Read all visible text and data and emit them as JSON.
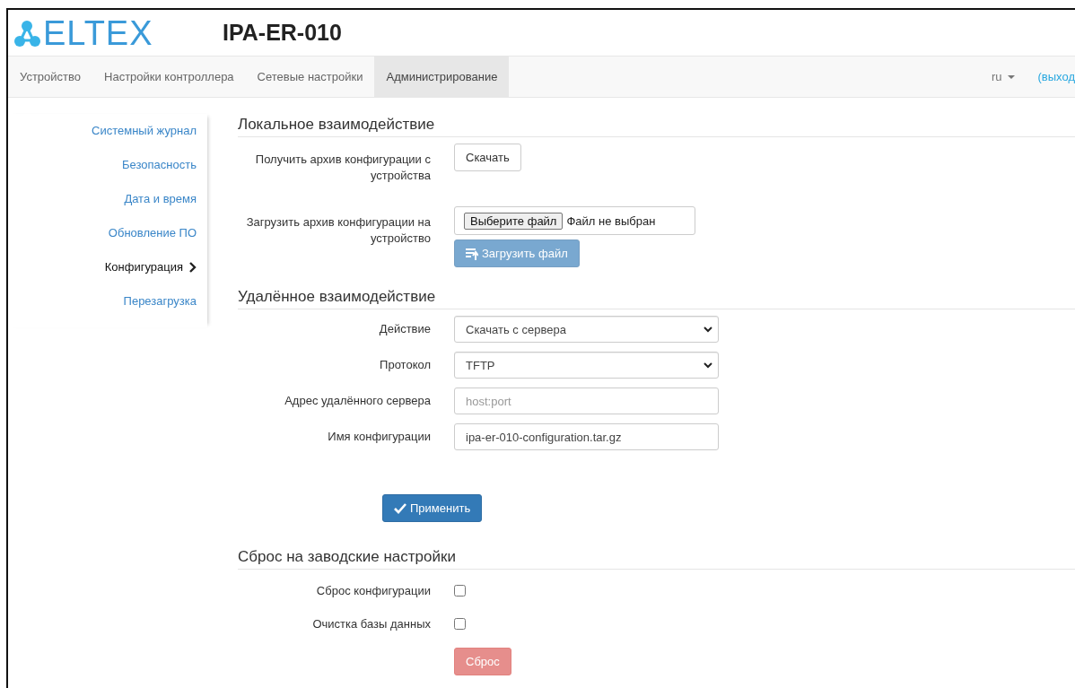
{
  "header": {
    "logo_text": "ELTEX",
    "title": "IPA-ER-010"
  },
  "navbar": {
    "tabs": [
      {
        "label": "Устройство",
        "selected": false
      },
      {
        "label": "Настройки контроллера",
        "selected": false
      },
      {
        "label": "Сетевые настройки",
        "selected": false
      },
      {
        "label": "Администрирование",
        "selected": true
      }
    ],
    "language": "ru",
    "logout": "(выход"
  },
  "sidebar": {
    "items": [
      {
        "label": "Системный журнал",
        "selected": false
      },
      {
        "label": "Безопасность",
        "selected": false
      },
      {
        "label": "Дата и время",
        "selected": false
      },
      {
        "label": "Обновление ПО",
        "selected": false
      },
      {
        "label": "Конфигурация",
        "selected": true
      },
      {
        "label": "Перезагрузка",
        "selected": false
      }
    ]
  },
  "sections": [
    {
      "title": "Локальное взаимодействие",
      "rows": [
        {
          "kind": "button",
          "label": "Получить архив конфигурации с устройства",
          "button": "Скачать"
        },
        {
          "kind": "file",
          "label": "Загрузить архив конфигурации на устройство",
          "choose_button": "Выберите файл",
          "file_status": "Файл не выбран",
          "upload_button": {
            "label": "Загрузить файл",
            "disabled": true
          }
        }
      ]
    },
    {
      "title": "Удалённое взаимодействие",
      "rows": [
        {
          "kind": "select",
          "label": "Действие",
          "value": "Скачать с сервера"
        },
        {
          "kind": "select",
          "label": "Протокол",
          "value": "TFTP"
        },
        {
          "kind": "input",
          "label": "Адрес удалённого сервера",
          "placeholder": "host:port"
        },
        {
          "kind": "input",
          "label": "Имя конфигурации",
          "value": "ipa-er-010-configuration.tar.gz"
        }
      ],
      "action": {
        "label": "Применить",
        "kind": "primary",
        "disabled": false
      }
    },
    {
      "title": "Сброс на заводские настройки",
      "rows": [
        {
          "kind": "checkbox",
          "label": "Сброс конфигурации",
          "checked": false
        },
        {
          "kind": "checkbox",
          "label": "Очистка базы данных",
          "checked": false
        }
      ],
      "action": {
        "label": "Сброс",
        "kind": "danger",
        "disabled": true
      }
    }
  ]
}
